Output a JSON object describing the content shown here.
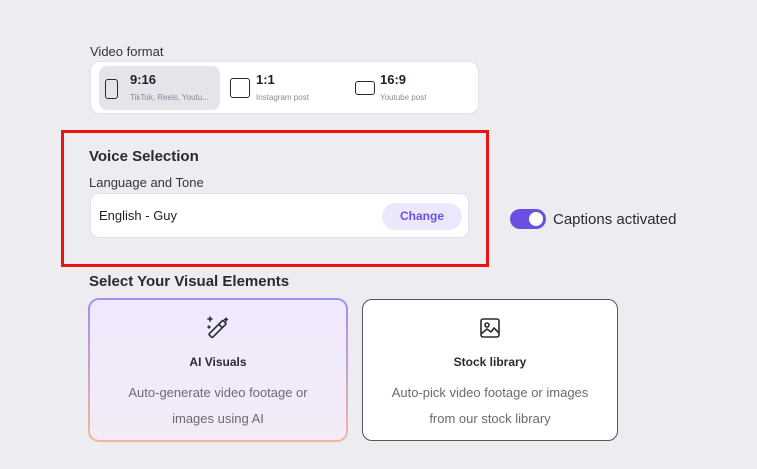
{
  "video_format": {
    "label": "Video format",
    "options": [
      {
        "ratio": "9:16",
        "sub": "TikTok, Reels, Youtu...",
        "icon": "portrait-frame-icon",
        "selected": true
      },
      {
        "ratio": "1:1",
        "sub": "Instagram post",
        "icon": "square-frame-icon",
        "selected": false
      },
      {
        "ratio": "16:9",
        "sub": "Youtube post",
        "icon": "landscape-frame-icon",
        "selected": false
      }
    ]
  },
  "voice": {
    "title": "Voice Selection",
    "language_label": "Language and Tone",
    "value": "English - Guy",
    "change_label": "Change"
  },
  "captions": {
    "label": "Captions activated",
    "enabled": true
  },
  "visual_elements": {
    "title": "Select Your Visual Elements",
    "cards": [
      {
        "name": "AI Visuals",
        "desc": "Auto-generate video footage or images using AI",
        "icon": "magic-wand-icon",
        "selected": true
      },
      {
        "name": "Stock library",
        "desc": "Auto-pick video footage or images from our stock library",
        "icon": "image-icon",
        "selected": false
      }
    ]
  },
  "colors": {
    "accent": "#6b4fe0",
    "highlight_border": "#ee1111",
    "background": "#ececf1"
  }
}
